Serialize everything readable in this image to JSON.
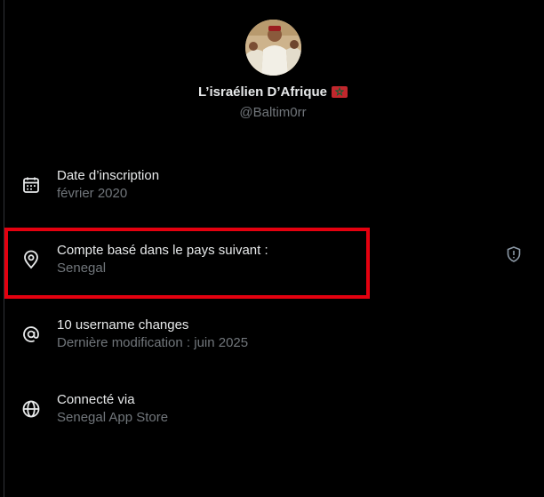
{
  "profile": {
    "display_name": "L’israélien D’Afrique",
    "handle": "@Baltim0rr",
    "flag_icon": "morocco-flag-icon",
    "flag_color": "#c1272d"
  },
  "rows": [
    {
      "title": "Date d’inscription",
      "subtitle": "février 2020",
      "icon": "calendar-icon"
    },
    {
      "title": "Compte basé dans le pays suivant :",
      "subtitle": "Senegal",
      "icon": "location-pin-icon",
      "action_icon": "shield-alert-icon"
    },
    {
      "title": "10 username changes",
      "subtitle": "Dernière modification : juin 2025",
      "icon": "at-sign-icon"
    },
    {
      "title": "Connecté via",
      "subtitle": "Senegal App Store",
      "icon": "globe-icon"
    }
  ],
  "colors": {
    "background": "#000000",
    "primary_text": "#e7e9ea",
    "secondary_text": "#71767b",
    "highlight": "#e4000f"
  }
}
